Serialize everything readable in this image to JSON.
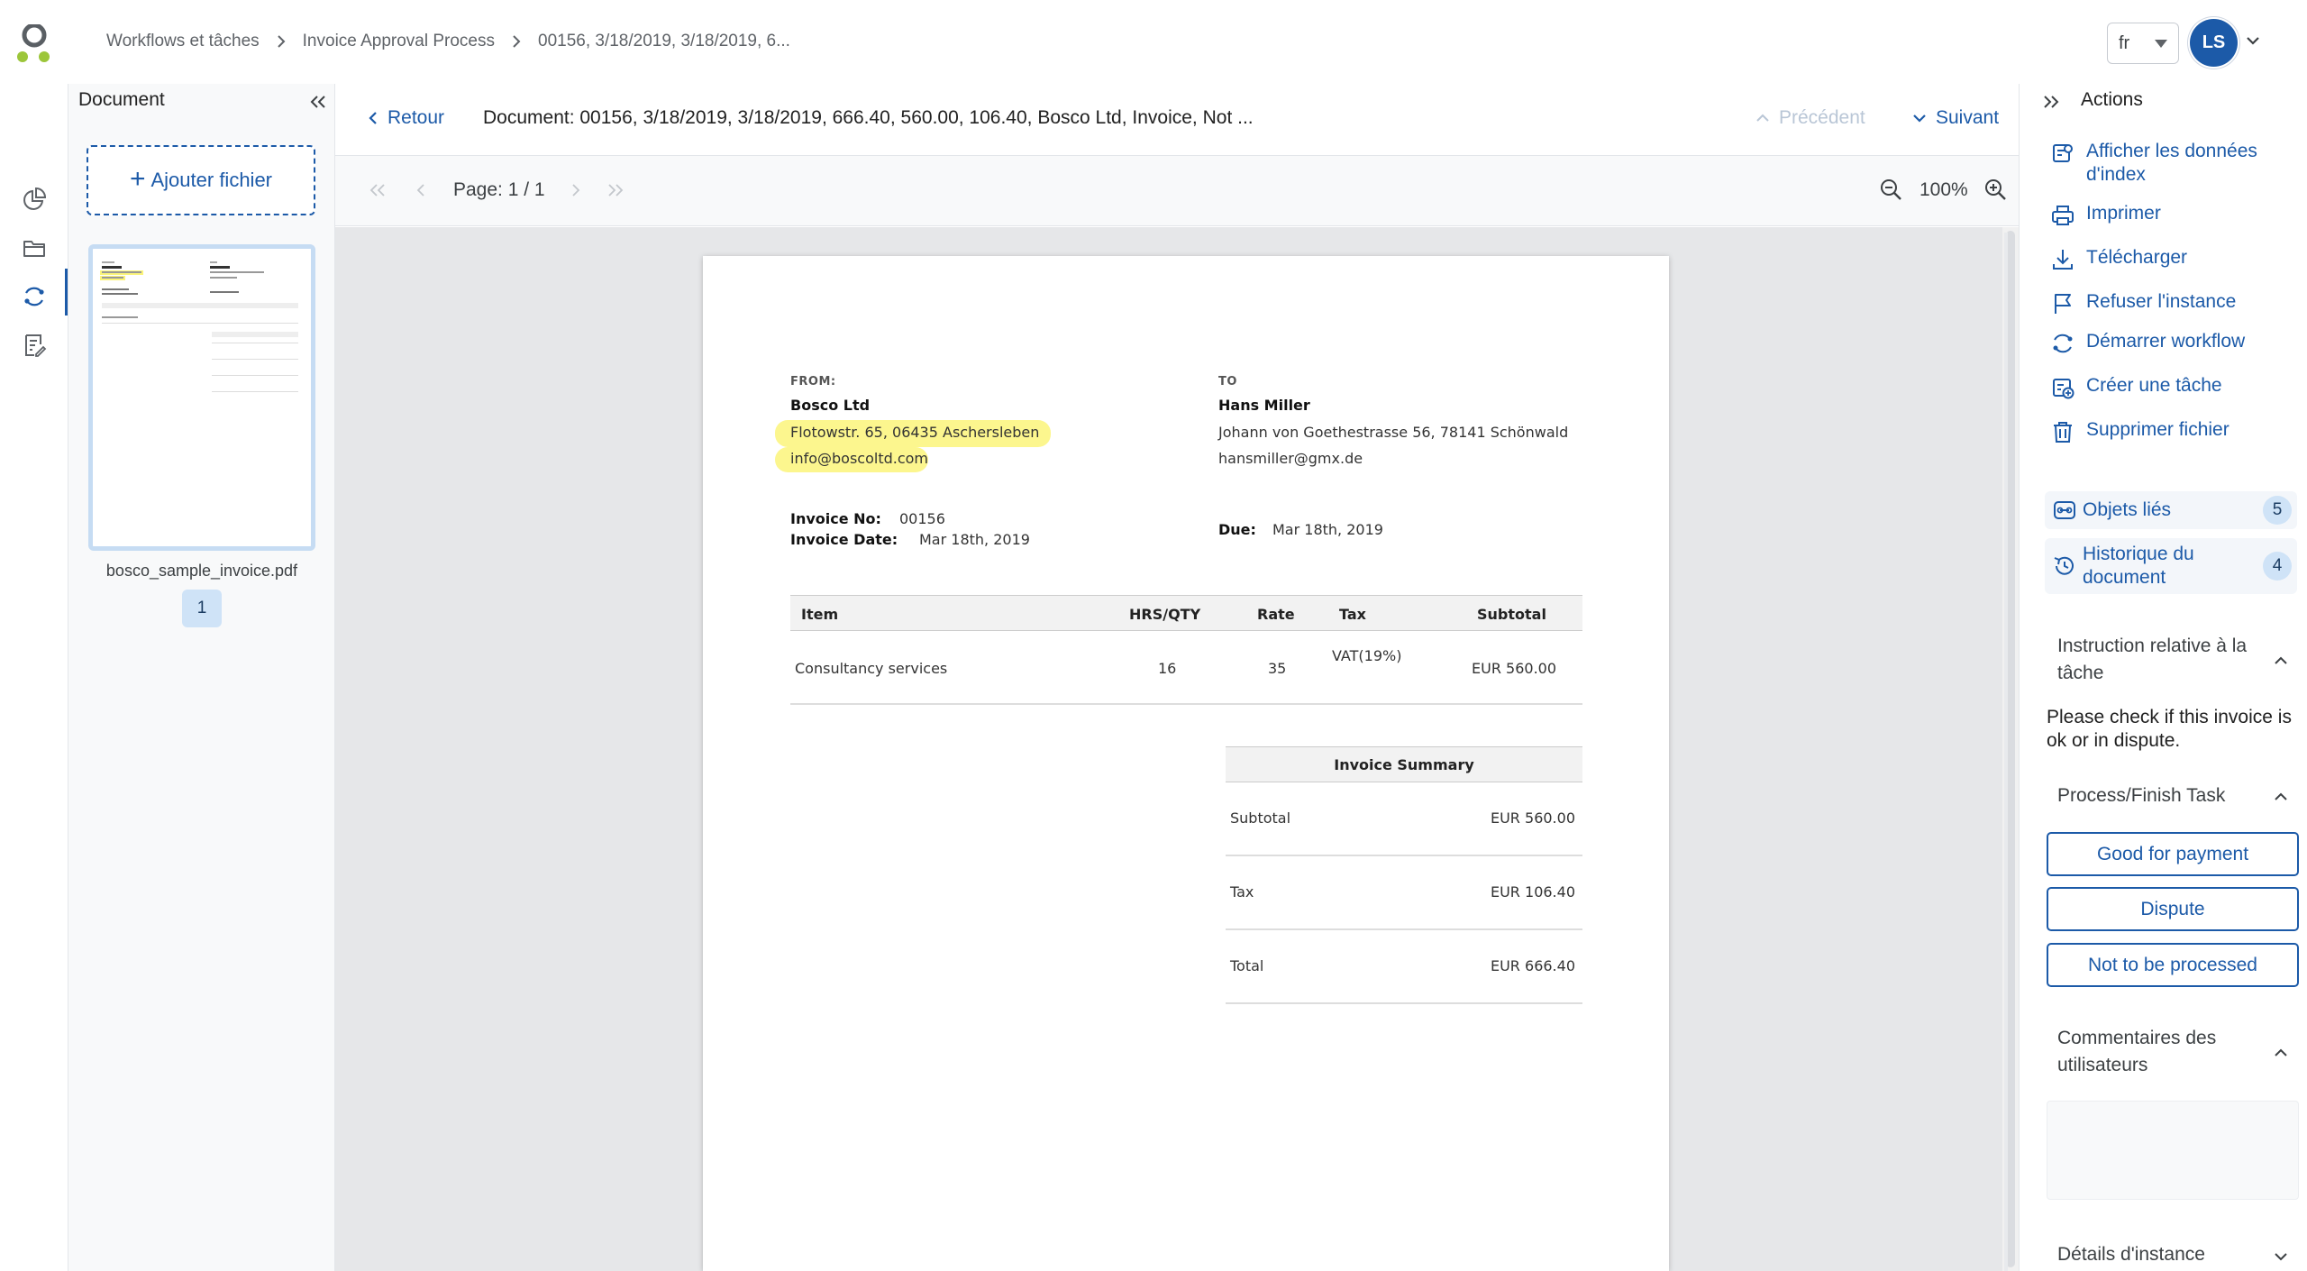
{
  "header": {
    "breadcrumb": [
      "Workflows et tâches",
      "Invoice Approval Process",
      "00156, 3/18/2019, 3/18/2019, 6..."
    ],
    "language": "fr",
    "user_initials": "LS"
  },
  "rail": {
    "icons": [
      "dashboard-icon",
      "folder-icon",
      "workflow-icon",
      "tasks-icon"
    ],
    "active": "workflow-icon"
  },
  "doc_panel": {
    "title": "Document",
    "add_file_label": "Ajouter fichier",
    "file_name": "bosco_sample_invoice.pdf",
    "page_badge": "1"
  },
  "viewer": {
    "back_label": "Retour",
    "title": "Document: 00156, 3/18/2019, 3/18/2019, 666.40, 560.00, 106.40, Bosco Ltd, Invoice, Not ...",
    "prev_label": "Précédent",
    "next_label": "Suivant",
    "page_label": "Page: 1 / 1",
    "zoom": "100%"
  },
  "invoice": {
    "from_label": "FROM:",
    "from_name": "Bosco Ltd",
    "from_address": "Flotowstr. 65, 06435 Aschersleben",
    "from_email": "info@boscoltd.com",
    "to_label": "TO",
    "to_name": "Hans Miller",
    "to_address": "Johann von Goethestrasse 56, 78141 Schönwald",
    "to_email": "hansmiller@gmx.de",
    "invoice_no_label": "Invoice No:",
    "invoice_no": "00156",
    "invoice_date_label": "Invoice Date:",
    "invoice_date": "Mar 18th, 2019",
    "due_label": "Due:",
    "due_date": "Mar 18th, 2019",
    "columns": [
      "Item",
      "HRS/QTY",
      "Rate",
      "Tax",
      "Subtotal"
    ],
    "line_items": [
      {
        "item": "Consultancy services",
        "qty": "16",
        "rate": "35",
        "tax": "VAT(19%)",
        "subtotal": "EUR 560.00"
      }
    ],
    "summary_title": "Invoice Summary",
    "summary": [
      {
        "label": "Subtotal",
        "value": "EUR 560.00"
      },
      {
        "label": "Tax",
        "value": "EUR 106.40"
      },
      {
        "label": "Total",
        "value": "EUR 666.40"
      }
    ]
  },
  "actions": {
    "title": "Actions",
    "items": [
      "Afficher les données d'index",
      "Imprimer",
      "Télécharger",
      "Refuser l'instance",
      "Démarrer workflow",
      "Créer une tâche",
      "Supprimer fichier"
    ],
    "linked_objects_label": "Objets liés",
    "linked_objects_count": "5",
    "history_label": "Historique du document",
    "history_count": "4",
    "instruction_title": "Instruction relative à la tâche",
    "instruction_text": "Please check if this invoice is ok or in dispute.",
    "process_title": "Process/Finish Task",
    "task_buttons": [
      "Good for payment",
      "Dispute",
      "Not to be processed"
    ],
    "comments_title": "Commentaires des utilisateurs",
    "details_title": "Détails d'instance"
  },
  "colors": {
    "accent": "#1c5aa8",
    "highlight": "#fbf47a",
    "badge_bg": "#cfe3f7"
  }
}
